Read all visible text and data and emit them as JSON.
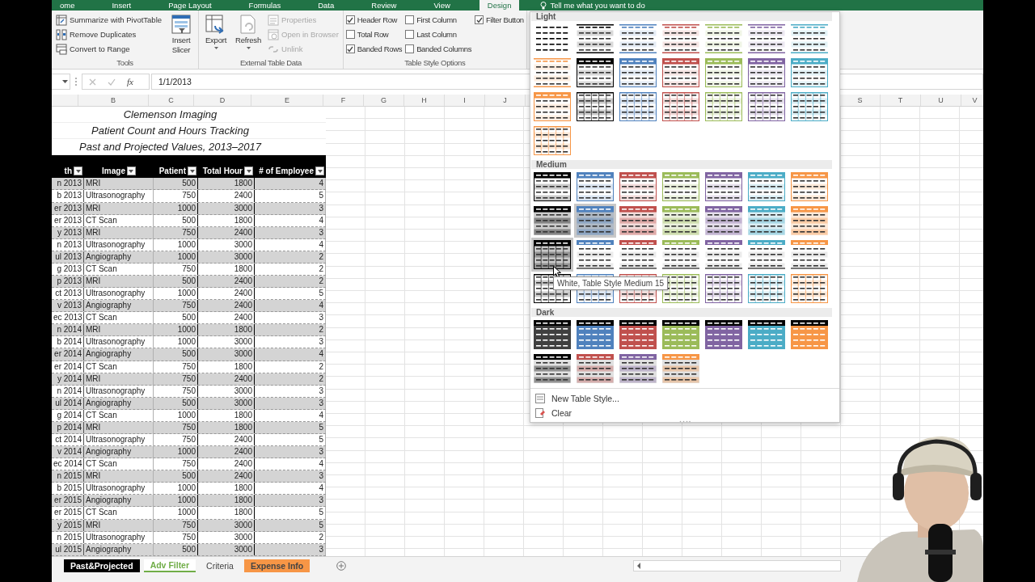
{
  "ribbon": {
    "tabs": [
      {
        "label": "ome",
        "selected": false
      },
      {
        "label": "Insert",
        "selected": false
      },
      {
        "label": "Page Layout",
        "selected": false
      },
      {
        "label": "Formulas",
        "selected": false
      },
      {
        "label": "Data",
        "selected": false
      },
      {
        "label": "Review",
        "selected": false
      },
      {
        "label": "View",
        "selected": false
      },
      {
        "label": "Design",
        "selected": true
      }
    ],
    "tell_me": "Tell me what you want to do",
    "groups": [
      {
        "title": "Tools",
        "items": [
          {
            "kind": "small",
            "label": "Summarize with PivotTable",
            "disabled": false
          },
          {
            "kind": "small",
            "label": "Remove Duplicates",
            "disabled": false
          },
          {
            "kind": "small",
            "label": "Convert to Range",
            "disabled": false
          },
          {
            "kind": "large",
            "label": "Insert Slicer",
            "disabled": false
          }
        ]
      },
      {
        "title": "External Table Data",
        "items": [
          {
            "kind": "large",
            "label": "Export",
            "disabled": false,
            "dropdown": true
          },
          {
            "kind": "large",
            "label": "Refresh",
            "disabled": false,
            "dropdown": true
          },
          {
            "kind": "small",
            "label": "Properties",
            "disabled": true
          },
          {
            "kind": "small",
            "label": "Open in Browser",
            "disabled": true
          },
          {
            "kind": "small",
            "label": "Unlink",
            "disabled": true
          }
        ]
      },
      {
        "title": "Table Style Options",
        "items": [
          {
            "kind": "checkbox",
            "label": "Header Row",
            "checked": true
          },
          {
            "kind": "checkbox",
            "label": "Total Row",
            "checked": false
          },
          {
            "kind": "checkbox",
            "label": "Banded Rows",
            "checked": true
          },
          {
            "kind": "checkbox",
            "label": "First Column",
            "checked": false
          },
          {
            "kind": "checkbox",
            "label": "Last Column",
            "checked": false
          },
          {
            "kind": "checkbox",
            "label": "Banded Columns",
            "checked": false
          },
          {
            "kind": "checkbox",
            "label": "Filter Button",
            "checked": true
          }
        ]
      }
    ]
  },
  "formula_bar": {
    "function_label": "fx",
    "value": "1/1/2013"
  },
  "sheet": {
    "columns_left": [
      "B",
      "C",
      "D",
      "E",
      "F",
      "G",
      "H",
      "I",
      "J"
    ],
    "columns_right": [
      "S",
      "T",
      "U",
      "V"
    ],
    "title_lines": [
      "Clemenson Imaging",
      "Patient Count and Hours Tracking",
      "Past and Projected Values, 2013–2017"
    ],
    "table": {
      "headers": [
        "th",
        "Image",
        "Patient",
        "Total Hour",
        "# of Employee"
      ],
      "rows": [
        [
          "n 2013",
          "MRI",
          "500",
          "1800",
          "4"
        ],
        [
          "b 2013",
          "Ultrasonography",
          "750",
          "2400",
          "5"
        ],
        [
          "er 2013",
          "MRI",
          "1000",
          "3000",
          "3"
        ],
        [
          "er 2013",
          "CT Scan",
          "500",
          "1800",
          "4"
        ],
        [
          "y 2013",
          "MRI",
          "750",
          "2400",
          "3"
        ],
        [
          "n 2013",
          "Ultrasonography",
          "1000",
          "3000",
          "4"
        ],
        [
          "ul 2013",
          "Angiography",
          "1000",
          "3000",
          "2"
        ],
        [
          "g 2013",
          "CT Scan",
          "750",
          "1800",
          "2"
        ],
        [
          "p 2013",
          "MRI",
          "500",
          "2400",
          "2"
        ],
        [
          "ct 2013",
          "Ultrasonography",
          "1000",
          "2400",
          "5"
        ],
        [
          "v 2013",
          "Angiography",
          "750",
          "2400",
          "4"
        ],
        [
          "ec 2013",
          "CT Scan",
          "500",
          "2400",
          "3"
        ],
        [
          "n 2014",
          "MRI",
          "1000",
          "1800",
          "2"
        ],
        [
          "b 2014",
          "Ultrasonography",
          "1000",
          "3000",
          "3"
        ],
        [
          "er 2014",
          "Angiography",
          "500",
          "3000",
          "4"
        ],
        [
          "er 2014",
          "CT Scan",
          "750",
          "1800",
          "2"
        ],
        [
          "y 2014",
          "MRI",
          "750",
          "2400",
          "2"
        ],
        [
          "n 2014",
          "Ultrasonography",
          "750",
          "3000",
          "3"
        ],
        [
          "ul 2014",
          "Angiography",
          "500",
          "3000",
          "3"
        ],
        [
          "g 2014",
          "CT Scan",
          "1000",
          "1800",
          "4"
        ],
        [
          "p 2014",
          "MRI",
          "750",
          "1800",
          "5"
        ],
        [
          "ct 2014",
          "Ultrasonography",
          "750",
          "2400",
          "5"
        ],
        [
          "v 2014",
          "Angiography",
          "1000",
          "2400",
          "3"
        ],
        [
          "ec 2014",
          "CT Scan",
          "750",
          "2400",
          "4"
        ],
        [
          "n 2015",
          "MRI",
          "500",
          "2400",
          "3"
        ],
        [
          "b 2015",
          "Ultrasonography",
          "1000",
          "1800",
          "4"
        ],
        [
          "er 2015",
          "Angiography",
          "1000",
          "1800",
          "3"
        ],
        [
          "er 2015",
          "CT Scan",
          "1000",
          "1800",
          "5"
        ],
        [
          "y 2015",
          "MRI",
          "750",
          "3000",
          "5"
        ],
        [
          "n 2015",
          "Ultrasonography",
          "750",
          "3000",
          "2"
        ],
        [
          "ul 2015",
          "Angiography",
          "500",
          "3000",
          "3"
        ]
      ]
    }
  },
  "gallery": {
    "sections": [
      {
        "title": "Light",
        "styles": [
          {
            "kind": "plain",
            "color": "#000000",
            "selected": false
          },
          {
            "kind": "lines",
            "color": "#000000",
            "selected": false
          },
          {
            "kind": "lines",
            "color": "#4f81bd",
            "selected": false
          },
          {
            "kind": "lines",
            "color": "#c0504d",
            "selected": false
          },
          {
            "kind": "lines",
            "color": "#9bbb59",
            "selected": false
          },
          {
            "kind": "lines",
            "color": "#8064a2",
            "selected": false
          },
          {
            "kind": "lines",
            "color": "#4bacc6",
            "selected": false
          },
          {
            "kind": "lines",
            "color": "#f79646",
            "selected": false
          },
          {
            "kind": "header",
            "color": "#000000",
            "selected": false
          },
          {
            "kind": "header",
            "color": "#4f81bd",
            "selected": false
          },
          {
            "kind": "header",
            "color": "#c0504d",
            "selected": false
          },
          {
            "kind": "header",
            "color": "#9bbb59",
            "selected": false
          },
          {
            "kind": "header",
            "color": "#8064a2",
            "selected": false
          },
          {
            "kind": "header",
            "color": "#4bacc6",
            "selected": false
          },
          {
            "kind": "header",
            "color": "#f79646",
            "selected": false
          },
          {
            "kind": "grid",
            "color": "#000000",
            "selected": false
          },
          {
            "kind": "grid",
            "color": "#4f81bd",
            "selected": false
          },
          {
            "kind": "grid",
            "color": "#c0504d",
            "selected": false
          },
          {
            "kind": "grid",
            "color": "#9bbb59",
            "selected": false
          },
          {
            "kind": "grid",
            "color": "#8064a2",
            "selected": false
          },
          {
            "kind": "grid",
            "color": "#4bacc6",
            "selected": false
          },
          {
            "kind": "grid",
            "color": "#f79646",
            "selected": false
          }
        ]
      },
      {
        "title": "Medium",
        "styles": [
          {
            "kind": "banded",
            "color": "#000000",
            "selected": false
          },
          {
            "kind": "banded",
            "color": "#4f81bd",
            "selected": false
          },
          {
            "kind": "banded",
            "color": "#c0504d",
            "selected": false
          },
          {
            "kind": "banded",
            "color": "#9bbb59",
            "selected": false
          },
          {
            "kind": "banded",
            "color": "#8064a2",
            "selected": false
          },
          {
            "kind": "banded",
            "color": "#4bacc6",
            "selected": false
          },
          {
            "kind": "banded",
            "color": "#f79646",
            "selected": false
          },
          {
            "kind": "tinted",
            "color": "#000000",
            "selected": false
          },
          {
            "kind": "tinted",
            "color": "#4f81bd",
            "selected": true
          },
          {
            "kind": "tinted",
            "color": "#c0504d",
            "selected": false
          },
          {
            "kind": "tinted",
            "color": "#9bbb59",
            "selected": false
          },
          {
            "kind": "tinted",
            "color": "#8064a2",
            "selected": false
          },
          {
            "kind": "tinted",
            "color": "#4bacc6",
            "selected": false
          },
          {
            "kind": "tinted",
            "color": "#f79646",
            "selected": false
          },
          {
            "kind": "boxgrid",
            "color": "#000000",
            "selected": true
          },
          {
            "kind": "rules",
            "color": "#4f81bd",
            "selected": false
          },
          {
            "kind": "rules",
            "color": "#c0504d",
            "selected": false
          },
          {
            "kind": "rules",
            "color": "#9bbb59",
            "selected": false
          },
          {
            "kind": "rules",
            "color": "#8064a2",
            "selected": false
          },
          {
            "kind": "rules",
            "color": "#4bacc6",
            "selected": false
          },
          {
            "kind": "rules",
            "color": "#f79646",
            "selected": false
          },
          {
            "kind": "grid",
            "color": "#000000",
            "selected": false
          },
          {
            "kind": "grid",
            "color": "#4f81bd",
            "selected": false
          },
          {
            "kind": "grid",
            "color": "#c0504d",
            "selected": false
          },
          {
            "kind": "grid",
            "color": "#9bbb59",
            "selected": false
          },
          {
            "kind": "grid",
            "color": "#8064a2",
            "selected": false
          },
          {
            "kind": "grid",
            "color": "#4bacc6",
            "selected": false
          },
          {
            "kind": "grid",
            "color": "#f79646",
            "selected": false
          }
        ]
      },
      {
        "title": "Dark",
        "styles": [
          {
            "kind": "dark",
            "color": "#404040",
            "selected": false
          },
          {
            "kind": "dark",
            "color": "#4f81bd",
            "selected": false
          },
          {
            "kind": "dark",
            "color": "#c0504d",
            "selected": false
          },
          {
            "kind": "dark",
            "color": "#9bbb59",
            "selected": false
          },
          {
            "kind": "dark",
            "color": "#8064a2",
            "selected": false
          },
          {
            "kind": "dark",
            "color": "#4bacc6",
            "selected": false
          },
          {
            "kind": "dark",
            "color": "#f79646",
            "selected": false
          },
          {
            "kind": "dark2",
            "color": "#000000",
            "selected": false
          },
          {
            "kind": "dark2",
            "color": "#c0504d",
            "selected": false
          },
          {
            "kind": "dark2",
            "color": "#8064a2",
            "selected": false
          },
          {
            "kind": "dark2",
            "color": "#f79646",
            "selected": false
          }
        ]
      }
    ],
    "tooltip": "White, Table Style Medium 15",
    "footer": [
      "New Table Style...",
      "Clear"
    ]
  },
  "sheet_tabs": [
    {
      "label": "Past&Projected",
      "selected": false,
      "color": "#000000"
    },
    {
      "label": "Adv Filter",
      "selected": true,
      "color": "#70ad47"
    },
    {
      "label": "Criteria",
      "selected": false
    },
    {
      "label": "Expense Info",
      "selected": false,
      "color": "#f79646"
    }
  ]
}
